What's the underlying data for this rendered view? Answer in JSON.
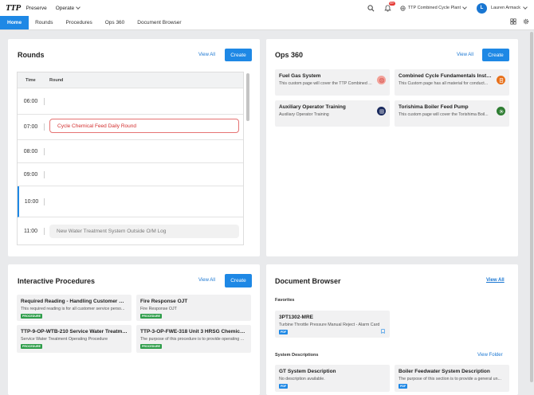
{
  "header": {
    "logo": "TTP",
    "app_name": "Preserve",
    "menu_label": "Operate",
    "notification_count": "99+",
    "plant": "TTP Combined Cycle Plant",
    "avatar_initial": "L",
    "user_name": "Lauren Armack"
  },
  "tabs": [
    "Home",
    "Rounds",
    "Procedures",
    "Ops 360",
    "Document Browser"
  ],
  "rounds": {
    "title": "Rounds",
    "view_all": "View All",
    "create": "Create",
    "col_time": "Time",
    "col_round": "Round",
    "rows": [
      "06:00",
      "07:00",
      "08:00",
      "09:00",
      "10:00",
      "11:00"
    ],
    "events": {
      "e1": "Cycle Chemical Feed Daily Round",
      "e2": "New Water Treatment System Outside O/M Log"
    }
  },
  "ops360": {
    "title": "Ops 360",
    "view_all": "View All",
    "create": "Create",
    "items": [
      {
        "title": "Fuel Gas System",
        "desc": "This custom page will cover the TTP Combined ..."
      },
      {
        "title": "Combined Cycle Fundamentals Instru...",
        "desc": "This Custom page has all material for conduct..."
      },
      {
        "title": "Auxiliary Operator Training",
        "desc": "Auxiliary Operator Training"
      },
      {
        "title": "Torishima Boiler Feed Pump",
        "desc": "This custom page will cover the Torishima Boil..."
      }
    ]
  },
  "procedures": {
    "title": "Interactive Procedures",
    "view_all": "View All",
    "create": "Create",
    "badge": "PROCEDURE",
    "items": [
      {
        "title": "Required Reading - Handling Customer Com...",
        "desc": "This required reading is for all customer service perso..."
      },
      {
        "title": "Fire Response OJT",
        "desc": "Fire Response OJT"
      },
      {
        "title": "TTP-9-OP-WTB-210 Service Water Treatment...",
        "desc": "Service Water Treatment Operating Procedure"
      },
      {
        "title": "TTP-3-OP-FWE-318 Unit 3 HRSG Chemical Inj...",
        "desc": "The purpose of this procedure is to provide operating ..."
      }
    ]
  },
  "documents": {
    "title": "Document Browser",
    "view_all": "View All",
    "favorites_label": "Favorites",
    "favorite": {
      "title": "3PT1302-MRE",
      "desc": "Turbine Throttle Pressure Manual Reject - Alarm Card",
      "badge": "PDF"
    },
    "system_label": "System Descriptions",
    "view_folder": "View Folder",
    "system_items": [
      {
        "title": "GT System Description",
        "desc": "No description available.",
        "badge": "PDF"
      },
      {
        "title": "Boiler Feedwater System Description",
        "desc": "The purpose of this section is to provide a general un...",
        "badge": "PDF"
      }
    ]
  },
  "colors": {
    "accent": "#1e88e5",
    "event_red": "#d32f2f",
    "badge_green": "#2e9d4a"
  }
}
